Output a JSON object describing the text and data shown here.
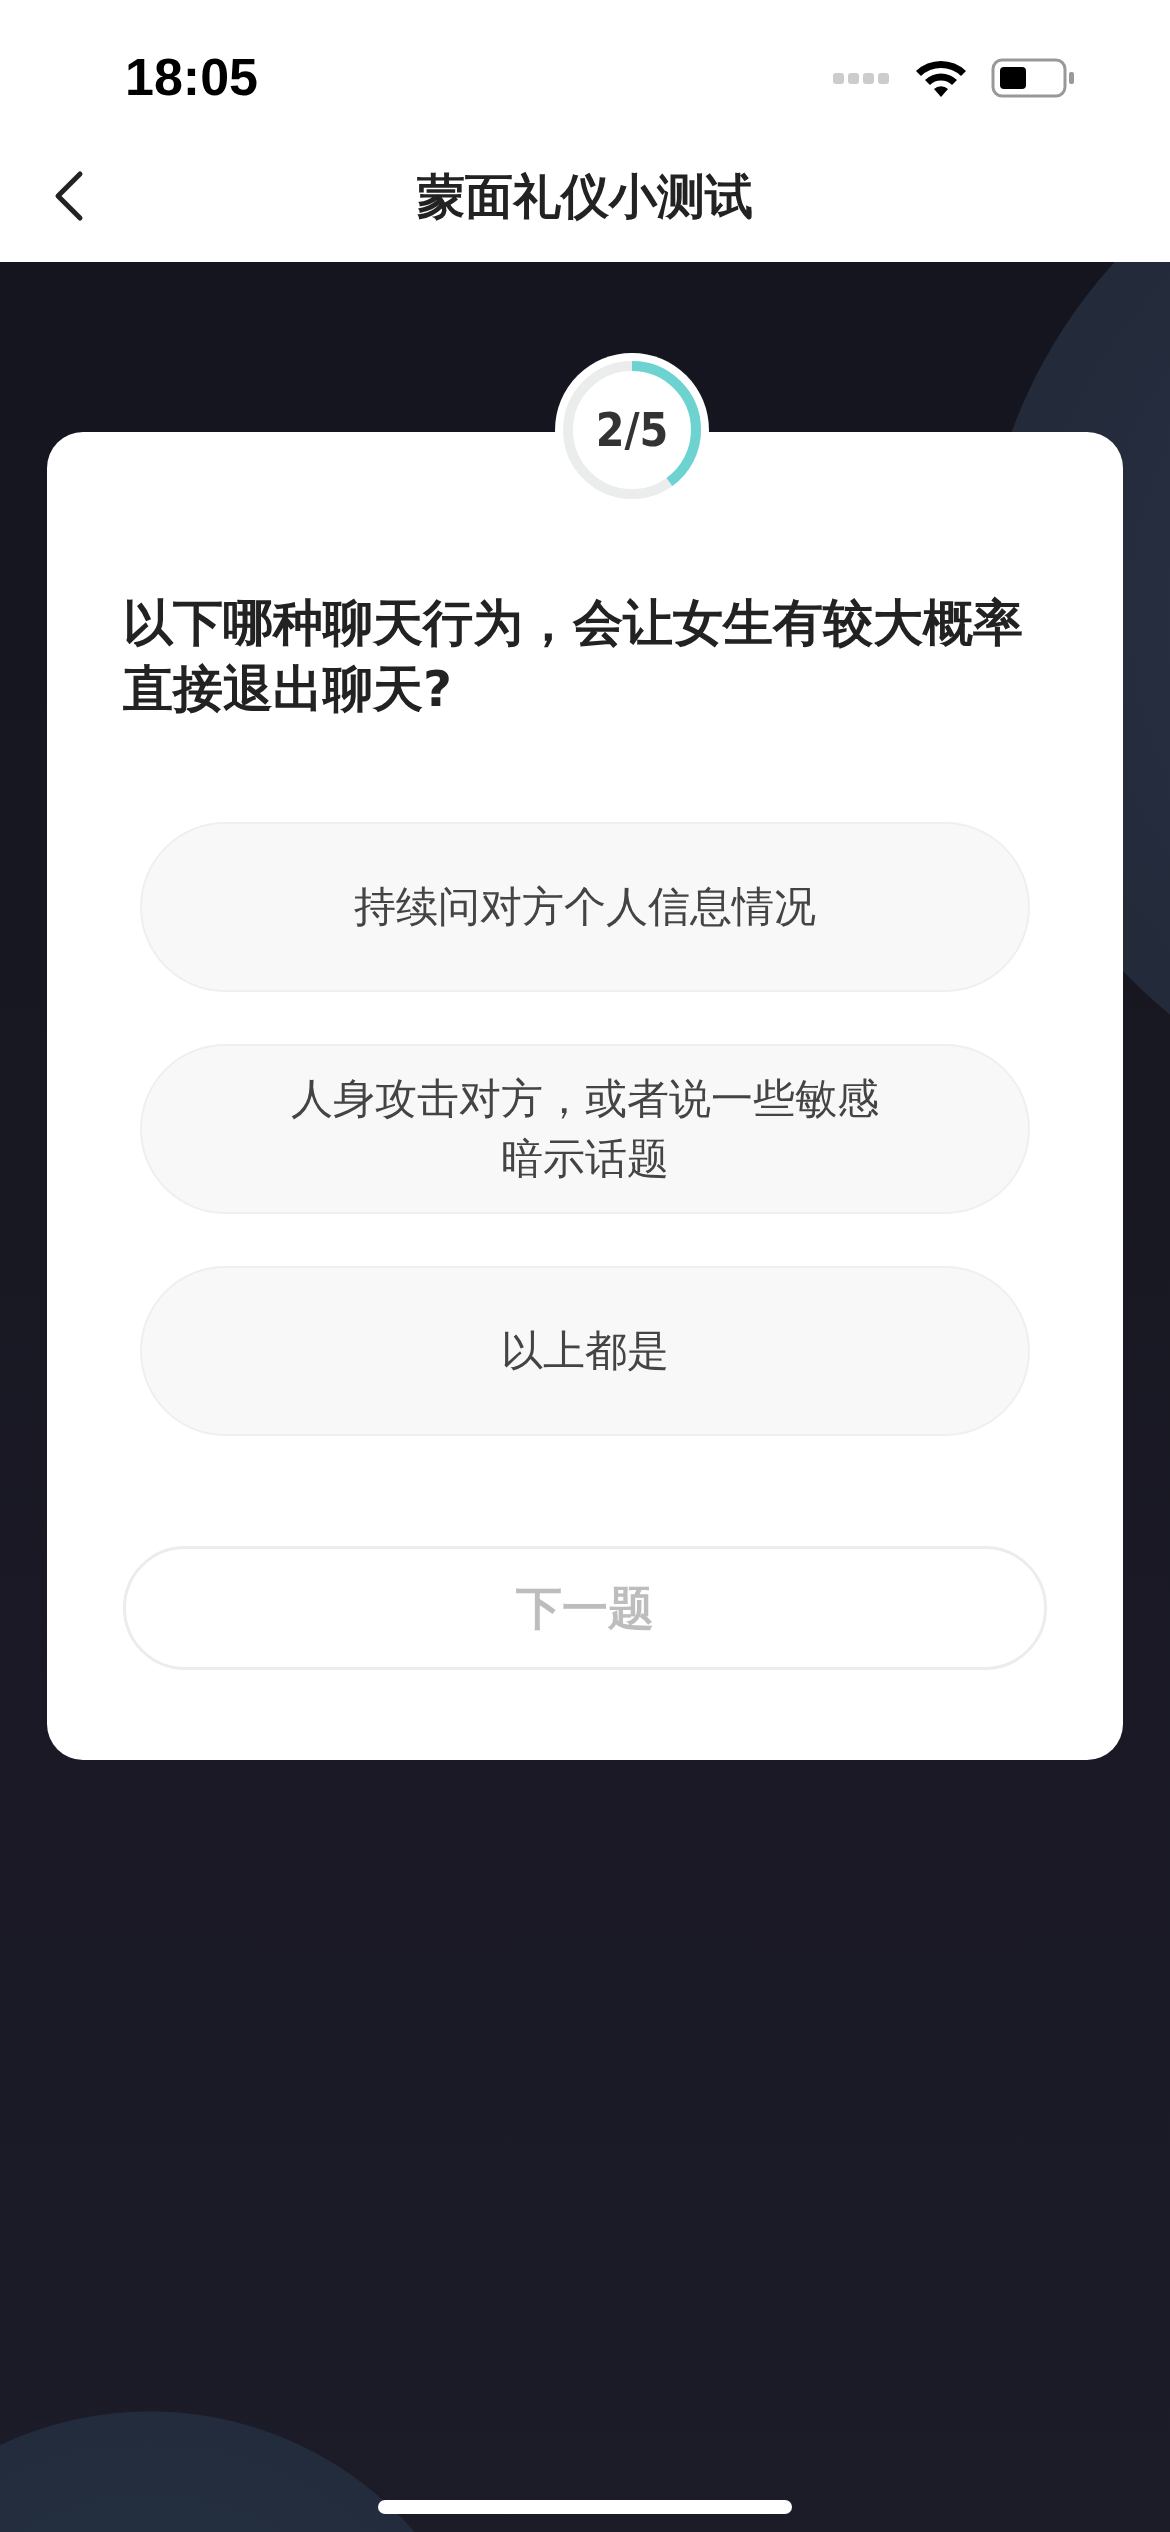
{
  "status_bar": {
    "time": "18:05"
  },
  "nav": {
    "title": "蒙面礼仪小测试"
  },
  "progress": {
    "text": "2/5",
    "level": 0.4
  },
  "question": "以下哪种聊天行为，会让女生有较大概率直接退出聊天?",
  "options": [
    {
      "text": "持续问对方个人信息情况",
      "selected": false
    },
    {
      "text": "人身攻击对方，或者说一些敏感暗示话题",
      "selected": false
    },
    {
      "text": "以上都是",
      "selected": false
    }
  ],
  "next_button": {
    "label": "下一题",
    "disabled": true
  }
}
